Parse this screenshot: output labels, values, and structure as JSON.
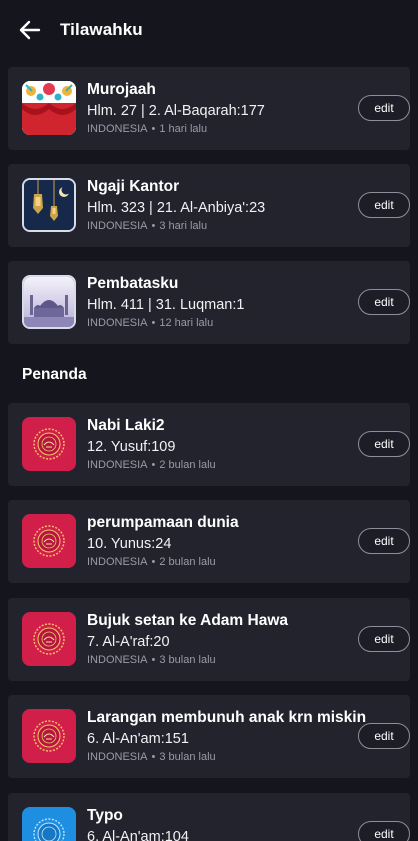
{
  "header": {
    "title": "Tilawahku"
  },
  "tilawah": [
    {
      "title": "Murojaah",
      "ref": "Hlm. 27 | 2. Al-Baqarah:177",
      "lang": "INDONESIA",
      "time": "1 hari lalu",
      "edit": "edit",
      "thumb": "pattern-red"
    },
    {
      "title": "Ngaji Kantor",
      "ref": "Hlm. 323 | 21. Al-Anbiya':23",
      "lang": "INDONESIA",
      "time": "3 hari lalu",
      "edit": "edit",
      "thumb": "lanterns-night"
    },
    {
      "title": "Pembatasku",
      "ref": "Hlm. 411 | 31. Luqman:1",
      "lang": "INDONESIA",
      "time": "12 hari lalu",
      "edit": "edit",
      "thumb": "mosque-light"
    }
  ],
  "section": {
    "title": "Penanda"
  },
  "penanda": [
    {
      "title": "Nabi Laki2",
      "ref": "12. Yusuf:109",
      "lang": "INDONESIA",
      "time": "2 bulan lalu",
      "edit": "edit",
      "thumb": "quran-emblem-red"
    },
    {
      "title": "perumpamaan dunia",
      "ref": "10. Yunus:24",
      "lang": "INDONESIA",
      "time": "2 bulan lalu",
      "edit": "edit",
      "thumb": "quran-emblem-red"
    },
    {
      "title": "Bujuk setan ke Adam Hawa",
      "ref": "7. Al-A'raf:20",
      "lang": "INDONESIA",
      "time": "3 bulan lalu",
      "edit": "edit",
      "thumb": "quran-emblem-red"
    },
    {
      "title": "Larangan membunuh anak krn miskin",
      "ref": "6. Al-An'am:151",
      "lang": "INDONESIA",
      "time": "3 bulan lalu",
      "edit": "edit",
      "thumb": "quran-emblem-red"
    },
    {
      "title": "Typo",
      "ref": "6. Al-An'am:104",
      "lang": "",
      "time": "",
      "edit": "edit",
      "thumb": "quran-emblem-blue"
    }
  ],
  "colors": {
    "background": "#15161d",
    "card": "#22232d",
    "accent_red": "#d21f4a",
    "accent_blue": "#1e8fe0"
  }
}
